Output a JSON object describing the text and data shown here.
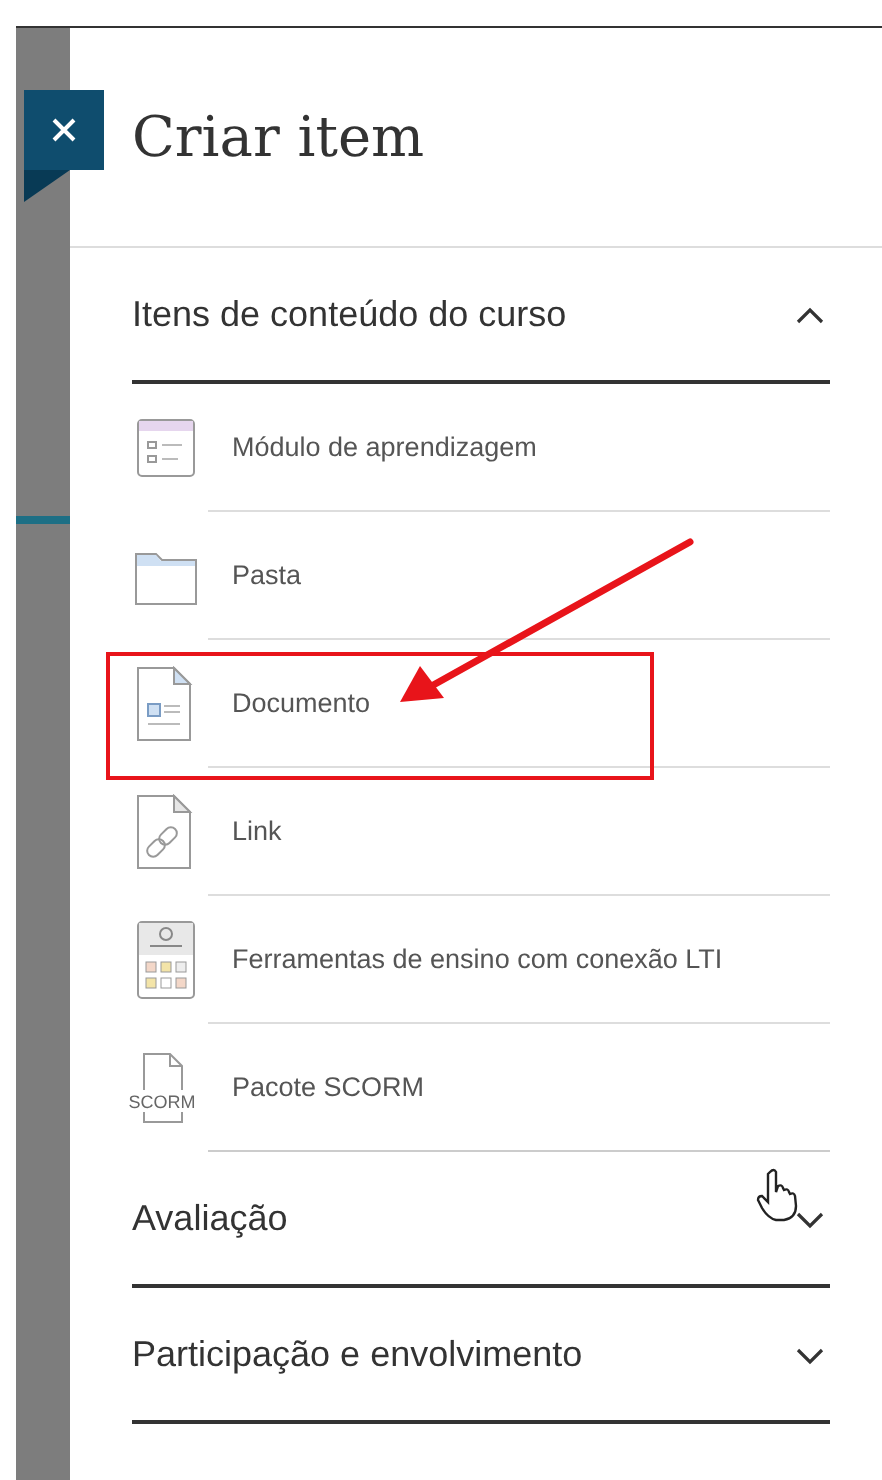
{
  "panel": {
    "title": "Criar item"
  },
  "sections": [
    {
      "title": "Itens de conteúdo do curso",
      "expanded": true,
      "items": [
        {
          "label": "Módulo de aprendizagem",
          "kind": "module",
          "highlighted": false
        },
        {
          "label": "Pasta",
          "kind": "folder",
          "highlighted": false
        },
        {
          "label": "Documento",
          "kind": "document",
          "highlighted": true
        },
        {
          "label": "Link",
          "kind": "link",
          "highlighted": false
        },
        {
          "label": "Ferramentas de ensino com conexão LTI",
          "kind": "lti",
          "highlighted": false
        },
        {
          "label": "Pacote SCORM",
          "kind": "scorm",
          "icon_label": "SCORM",
          "highlighted": false
        }
      ]
    },
    {
      "title": "Avaliação",
      "expanded": false,
      "hovered": true
    },
    {
      "title": "Participação e envolvimento",
      "expanded": false,
      "hovered": false
    }
  ]
}
